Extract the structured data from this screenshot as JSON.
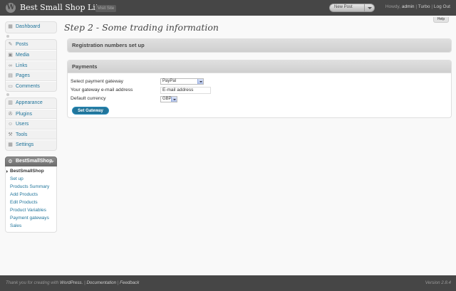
{
  "header": {
    "site_title": "Best Small Shop Lite",
    "visit_site": "Visit Site",
    "favorite_action": "New Post",
    "howdy": "Howdy,",
    "username": "admin",
    "turbo": "Turbo",
    "separator": "|",
    "logout": "Log Out"
  },
  "help": {
    "label": "Help"
  },
  "sidebar": {
    "dashboard": "Dashboard",
    "group2": [
      "Posts",
      "Media",
      "Links",
      "Pages",
      "Comments"
    ],
    "group3": [
      "Appearance",
      "Plugins",
      "Users",
      "Tools",
      "Settings"
    ],
    "plugin_menu": {
      "title": "BestSmallShop",
      "items": [
        "BestSmallShop",
        "Set up",
        "Products Summary",
        "Add Products",
        "Edit Products",
        "Product Variables",
        "Payment gateways",
        "Sales"
      ]
    }
  },
  "main": {
    "heading": "Step 2 - Some trading information",
    "registration_box_title": "Registration numbers set up",
    "payments_box_title": "Payments",
    "form": {
      "gateway_label": "Select payment gateway",
      "gateway_value": "PayPal",
      "email_label": "Your gateway e-mail address",
      "email_value": "E-mail address",
      "currency_label": "Default currency",
      "currency_value": "GBP",
      "submit": "Set Gateway"
    }
  },
  "footer": {
    "thanks": "Thank you for creating with",
    "wordpress": "WordPress.",
    "documentation": "Documentation",
    "feedback": "Feedback",
    "sep": "|",
    "version": "Version 2.8.4"
  }
}
